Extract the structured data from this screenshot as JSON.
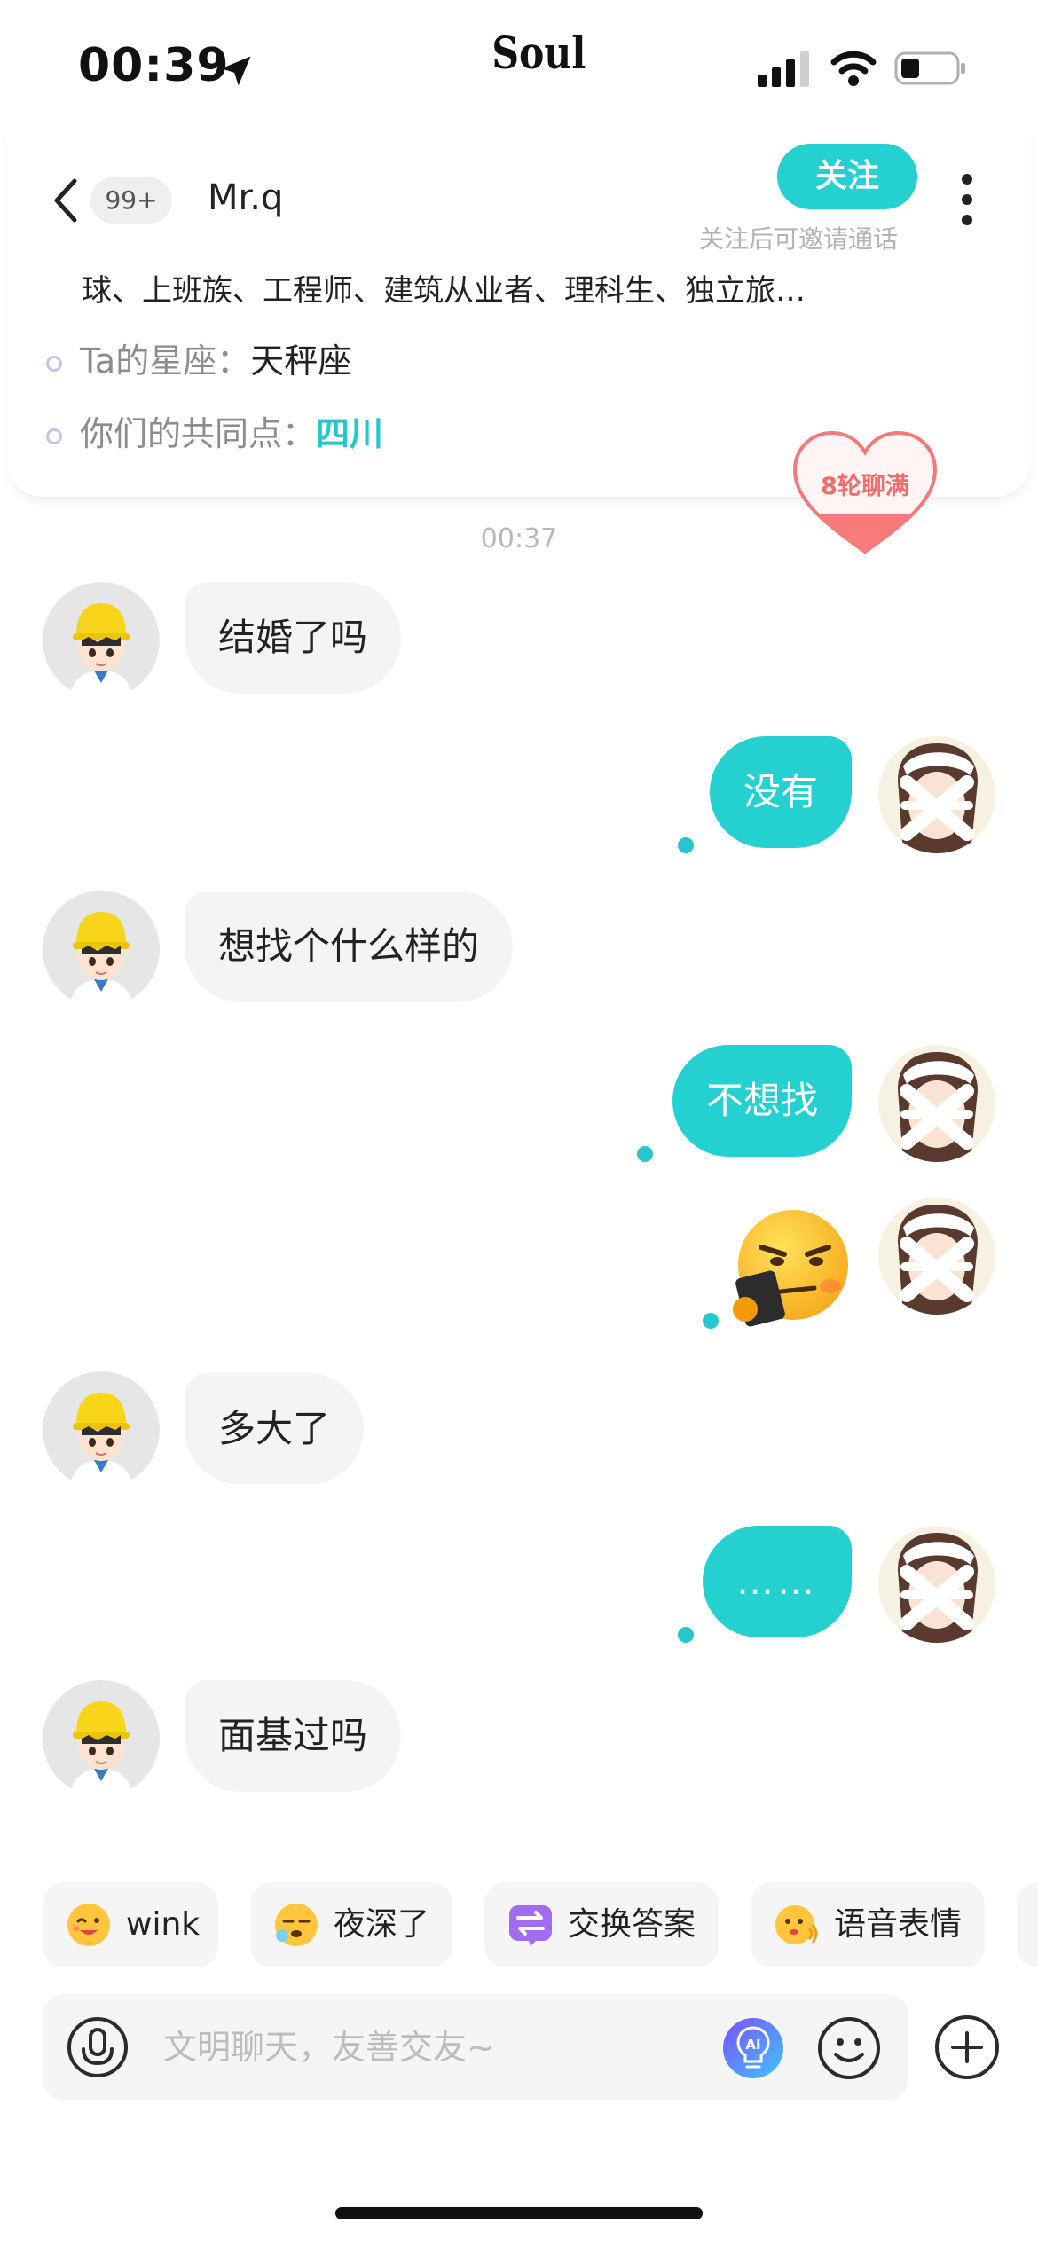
{
  "status_bar": {
    "time": "00:39",
    "app_logo": "Soul",
    "icons": [
      "location-arrow-icon",
      "signal-icon",
      "wifi-icon",
      "battery-icon"
    ]
  },
  "header": {
    "unread_badge": "99+",
    "contact_name": "Mr.q",
    "follow_label": "关注",
    "follow_hint": "关注后可邀请通话",
    "tags_line": "球、上班族、工程师、建筑从业者、理科生、独立旅…",
    "zodiac_label": "Ta的星座：",
    "zodiac_value": "天秤座",
    "common_label": "你们的共同点：",
    "common_value": "四川",
    "heart_badge": "8轮聊满"
  },
  "chat": {
    "timestamp": "00:37",
    "messages": [
      {
        "from": "them",
        "text": "结婚了吗"
      },
      {
        "from": "me",
        "text": "没有"
      },
      {
        "from": "them",
        "text": "想找个什么样的"
      },
      {
        "from": "me",
        "text": "不想找"
      },
      {
        "from": "me",
        "type": "sticker",
        "icon": "smug-tablet-emoji-icon"
      },
      {
        "from": "them",
        "text": "多大了"
      },
      {
        "from": "me",
        "text": "……"
      },
      {
        "from": "them",
        "text": "面基过吗"
      }
    ]
  },
  "quick_replies": [
    {
      "label": "wink",
      "icon": "wink-emoji-icon"
    },
    {
      "label": "夜深了",
      "icon": "sleepy-emoji-icon"
    },
    {
      "label": "交换答案",
      "icon": "exchange-icon"
    },
    {
      "label": "语音表情",
      "icon": "voice-emoji-icon"
    }
  ],
  "input": {
    "placeholder": "文明聊天，友善交友~",
    "value": ""
  },
  "colors": {
    "accent": "#25d0d0",
    "incoming_bubble": "#f4f4f4",
    "heart": "#f36b6b",
    "zodiac_dot": "#c7c3e8"
  }
}
